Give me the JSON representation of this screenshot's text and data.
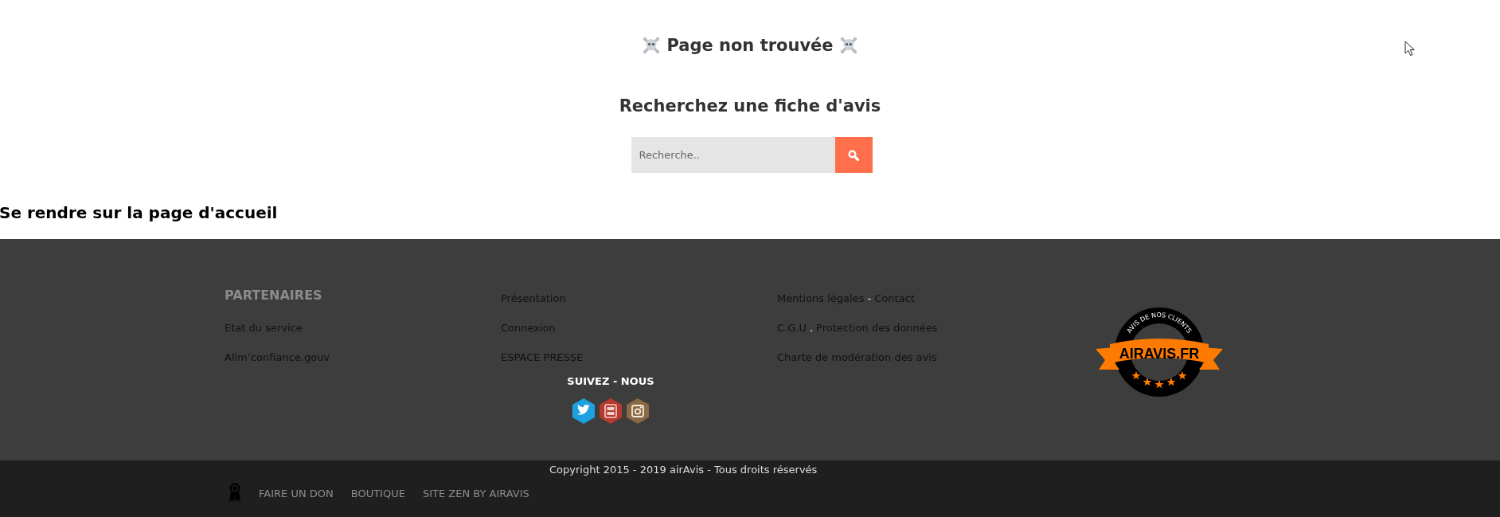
{
  "main": {
    "title": "Page non trouvée",
    "search_heading": "Recherchez une fiche d'avis",
    "search": {
      "placeholder": "Recherche.."
    },
    "home_link": "Se rendre sur la page d'accueil"
  },
  "footer": {
    "columns": [
      {
        "heading": "PARTENAIRES",
        "lines": [
          [
            {
              "kind": "link",
              "text": "Etat du service"
            }
          ],
          [
            {
              "kind": "link",
              "text": "Alim’confiance.gouv"
            }
          ]
        ]
      },
      {
        "lines": [
          [
            {
              "kind": "link",
              "text": "Présentation"
            }
          ],
          [
            {
              "kind": "link",
              "text": "Connexion"
            }
          ],
          [
            {
              "kind": "link",
              "text": "ESPACE PRESSE"
            }
          ]
        ],
        "follow_heading": "SUIVEZ - NOUS",
        "social": [
          {
            "kind": "twitter"
          },
          {
            "kind": "youtube"
          },
          {
            "kind": "instagram"
          }
        ]
      },
      {
        "lines": [
          [
            {
              "kind": "link",
              "text": "Mentions légales"
            },
            {
              "kind": "separator",
              "text": "-"
            },
            {
              "kind": "link",
              "text": "Contact"
            }
          ],
          [
            {
              "kind": "link",
              "text": "C.G.U"
            },
            {
              "kind": "separator",
              "text": "."
            },
            {
              "kind": "link",
              "text": "Protection des données"
            }
          ],
          [
            {
              "kind": "link",
              "text": "Charte de modération des avis"
            }
          ]
        ]
      }
    ],
    "badge": {
      "arc_text": "AVIS DE NOS CLIENTS",
      "ribbon_text": "AIRAVIS.FR"
    }
  },
  "bottom_bar": {
    "copyright": "Copyright 2015 - 2019 airAvis - Tous droits réservés",
    "links": [
      "FAIRE UN DON",
      "BOUTIQUE",
      "SITE ZEN BY AIRAVIS"
    ]
  }
}
